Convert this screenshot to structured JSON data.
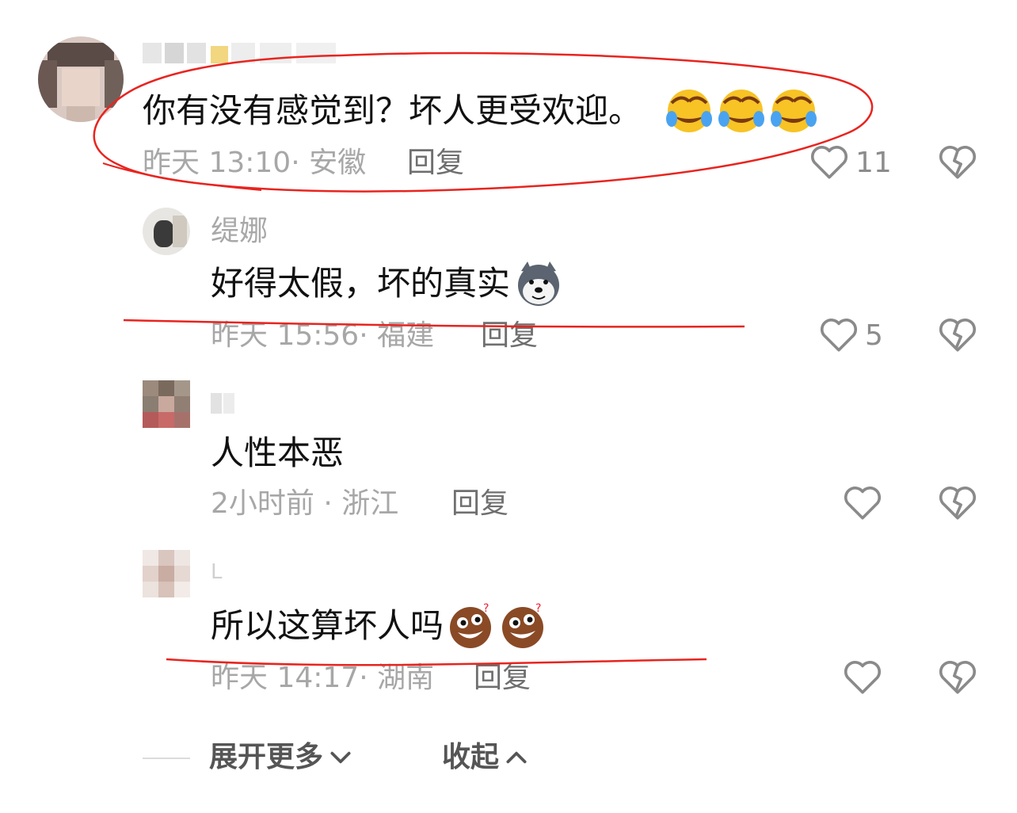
{
  "comments": [
    {
      "text": "你有没有感觉到？坏人更受欢迎。",
      "time": "昨天 13:10",
      "location": "安徽",
      "reply": "回复",
      "likes": "11",
      "emojis": [
        "laughing-cry-emoji",
        "laughing-cry-emoji",
        "laughing-cry-emoji"
      ]
    },
    {
      "name": "缇娜",
      "text": "好得太假，坏的真实",
      "time": "昨天 15:56",
      "location": "福建",
      "reply": "回复",
      "likes": "5",
      "emojis": [
        "husky-dog-emoji"
      ]
    },
    {
      "text": "人性本恶",
      "time": "2小时前",
      "location": "浙江",
      "reply": "回复",
      "likes": ""
    },
    {
      "name": "L",
      "text": "所以这算坏人吗",
      "time": "昨天 14:17",
      "location": "湖南",
      "reply": "回复",
      "likes": "",
      "emojis": [
        "confused-face-emoji",
        "confused-face-emoji"
      ]
    }
  ],
  "footer": {
    "expand": "展开更多",
    "collapse": "收起"
  },
  "colors": {
    "annotation": "#e8241f",
    "muted": "#a7a7a7",
    "icon": "#8a8a8a"
  }
}
